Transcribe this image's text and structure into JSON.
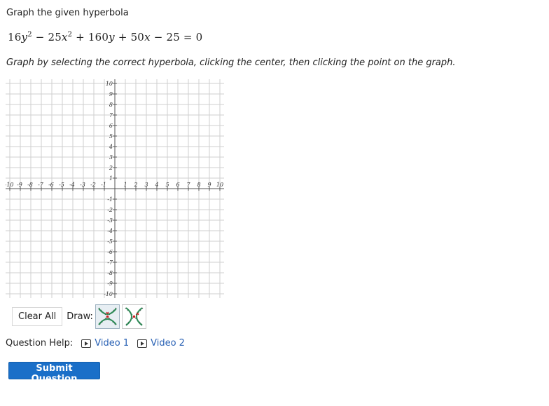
{
  "prompt": "Graph the given hyperbola",
  "equation": {
    "t1": "16",
    "t1_var": "y",
    "t1_exp": "2",
    "op1": "−",
    "t2": "25",
    "t2_var": "x",
    "t2_exp": "2",
    "op2": "+",
    "t3": "160",
    "t3_var": "y",
    "op3": "+",
    "t4": "50",
    "t4_var": "x",
    "op4": "−",
    "t5": "25",
    "eq": "=",
    "rhs": "0"
  },
  "instructions": "Graph by selecting the correct hyperbola, clicking the center, then clicking the point on the graph.",
  "graph": {
    "x_min": -10,
    "x_max": 10,
    "y_min": -10,
    "y_max": 10,
    "x_ticks": [
      "-10",
      "-9",
      "-8",
      "-7",
      "-6",
      "-5",
      "-4",
      "-3",
      "-2",
      "-1",
      "1",
      "2",
      "3",
      "4",
      "5",
      "6",
      "7",
      "8",
      "9",
      "10"
    ],
    "y_ticks": [
      "10",
      "9",
      "8",
      "7",
      "6",
      "5",
      "4",
      "3",
      "2",
      "1",
      "-1",
      "-2",
      "-3",
      "-4",
      "-5",
      "-6",
      "-7",
      "-8",
      "-9",
      "-10"
    ],
    "grid": true,
    "grid_color": "#cfcfcf",
    "axis_color": "#555555"
  },
  "controls": {
    "clear_label": "Clear All",
    "draw_label": "Draw:",
    "tools": [
      {
        "icon": "vertical-hyperbola-icon",
        "selected": true
      },
      {
        "icon": "horizontal-hyperbola-icon",
        "selected": false
      }
    ]
  },
  "help": {
    "label": "Question Help:",
    "links": [
      {
        "icon": "video-icon",
        "label": "Video 1"
      },
      {
        "icon": "video-icon",
        "label": "Video 2"
      }
    ]
  },
  "submit_label": "Submit Question",
  "colors": {
    "link": "#2a62b5",
    "submit_bg": "#1a6fc8",
    "hyperbola_icon": "#2e8b57",
    "point_marker": "#cc2222"
  }
}
